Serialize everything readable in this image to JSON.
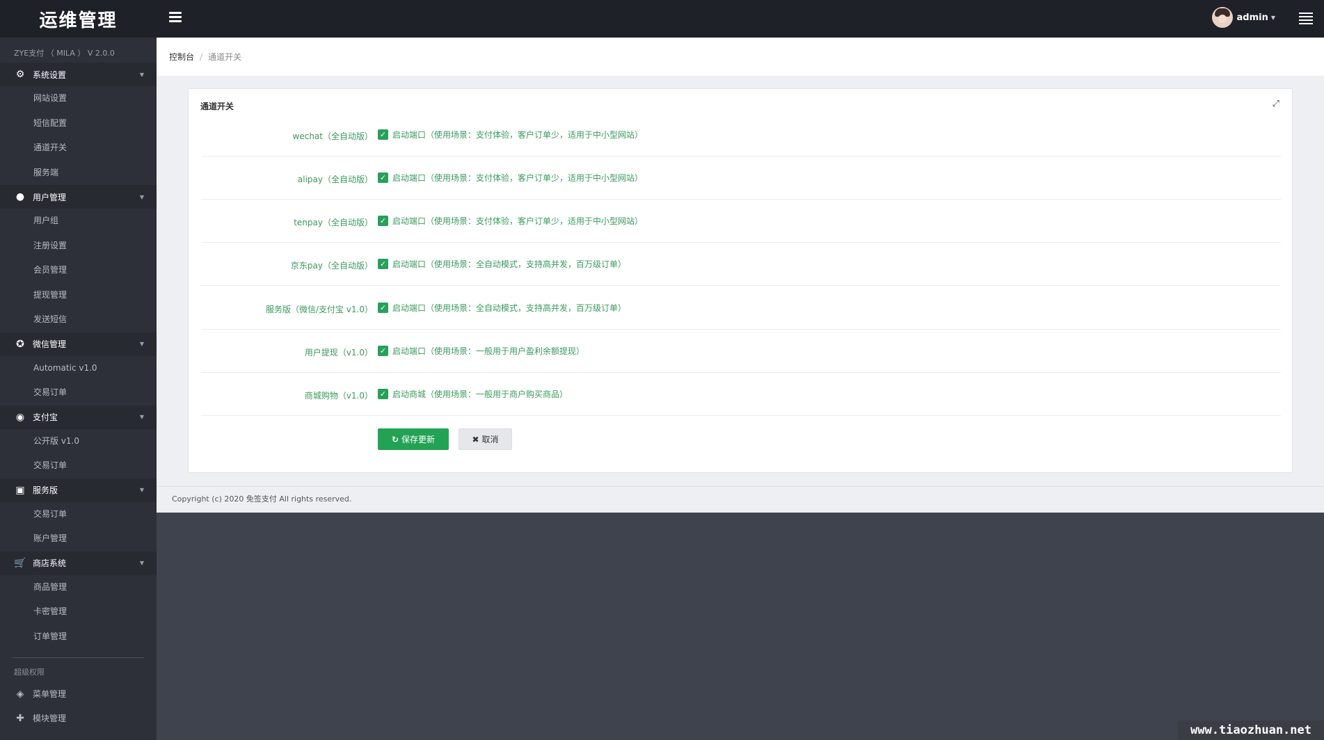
{
  "app": {
    "logo_text": "运维管理",
    "version": "ZYE支付 （ MILA ） V 2.0.0",
    "user": "admin"
  },
  "breadcrumb": {
    "home": "控制台",
    "separator": "/",
    "current": "通道开关"
  },
  "sidebar": {
    "groups": [
      {
        "label": "系统设置",
        "icon": "gear-icon",
        "items": [
          "网站设置",
          "短信配置",
          "通道开关",
          "服务端"
        ]
      },
      {
        "label": "用户管理",
        "icon": "user-icon",
        "items": [
          "用户组",
          "注册设置",
          "会员管理",
          "提现管理",
          "发送短信"
        ]
      },
      {
        "label": "微信管理",
        "icon": "wechat-icon",
        "items": [
          "Automatic v1.0",
          "交易订单"
        ]
      },
      {
        "label": "支付宝",
        "icon": "alipay-icon",
        "items": [
          "公开版 v1.0",
          "交易订单"
        ]
      },
      {
        "label": "服务版",
        "icon": "service-icon",
        "items": [
          "交易订单",
          "账户管理"
        ]
      },
      {
        "label": "商店系统",
        "icon": "cart-icon",
        "items": [
          "商品管理",
          "卡密管理",
          "订单管理"
        ]
      }
    ],
    "super_title": "超级权限",
    "extra_items": [
      {
        "label": "菜单管理",
        "icon": "cube-icon"
      },
      {
        "label": "模块管理",
        "icon": "puzzle-icon"
      }
    ]
  },
  "panel": {
    "title": "通道开关",
    "rows": [
      {
        "label": "wechat（全自动版）",
        "check": "启动端口（使用场景：支付体验，客户订单少，适用于中小型网站）"
      },
      {
        "label": "alipay（全自动版）",
        "check": "启动端口（使用场景：支付体验，客户订单少，适用于中小型网站）"
      },
      {
        "label": "tenpay（全自动版）",
        "check": "启动端口（使用场景：支付体验，客户订单少，适用于中小型网站）"
      },
      {
        "label": "京东pay（全自动版）",
        "check": "启动端口（使用场景：全自动模式，支持高并发，百万级订单）"
      },
      {
        "label": "服务版（微信/支付宝 v1.0）",
        "check": "启动端口（使用场景：全自动模式，支持高并发，百万级订单）"
      },
      {
        "label": "用户提现（v1.0）",
        "check": "启动端口（使用场景：一般用于用户盈利余额提现）"
      },
      {
        "label": "商城购物（v1.0）",
        "check": "启动商城（使用场景：一般用于商户购买商品）"
      }
    ],
    "save_label": "保存更新",
    "cancel_label": "取消"
  },
  "footer": {
    "copyright": "Copyright (c) 2020 免签支付 All rights reserved."
  },
  "watermark": "www.tiaozhuan.net",
  "colors": {
    "topbar": "#1f2128",
    "sidebar": "#2d3038",
    "accent_green": "#22a354",
    "label_green": "#3a9a5c"
  }
}
